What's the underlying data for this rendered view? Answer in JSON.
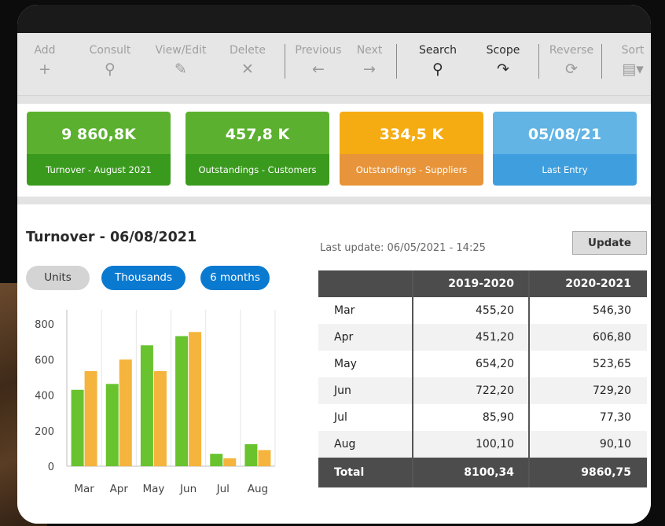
{
  "toolbar": {
    "items": [
      {
        "label": "Add",
        "icon": "plus-icon",
        "glyph": "+"
      },
      {
        "label": "Consult",
        "icon": "magnifier-icon",
        "glyph": "⚲"
      },
      {
        "label": "View/Edit",
        "icon": "pencil-icon",
        "glyph": "✎"
      },
      {
        "label": "Delete",
        "icon": "close-icon",
        "glyph": "✕"
      },
      {
        "label": "Previous",
        "icon": "arrow-left-icon",
        "glyph": "←"
      },
      {
        "label": "Next",
        "icon": "arrow-right-icon",
        "glyph": "→"
      },
      {
        "label": "Search",
        "icon": "search-icon",
        "glyph": "⚲"
      },
      {
        "label": "Scope",
        "icon": "redo-arrow-icon",
        "glyph": "↷"
      },
      {
        "label": "Reverse",
        "icon": "refresh-icon",
        "glyph": "⟳"
      },
      {
        "label": "Sort",
        "icon": "document-dropdown-icon",
        "glyph": "▤▾"
      }
    ]
  },
  "kpis": [
    {
      "value": "9 860,8K",
      "label": "Turnover - August 2021",
      "top": "#5bb12f",
      "bottom": "#3a9a1e"
    },
    {
      "value": "457,8 K",
      "label": "Outstandings - Customers",
      "top": "#5bb12f",
      "bottom": "#3a9a1e"
    },
    {
      "value": "334,5 K",
      "label": "Outstandings - Suppliers",
      "top": "#f5ac12",
      "bottom": "#e7943a"
    },
    {
      "value": "05/08/21",
      "label": "Last Entry",
      "top": "#62b4e4",
      "bottom": "#3f9edd"
    }
  ],
  "main": {
    "title": "Turnover - 06/08/2021",
    "last_update": "Last update: 06/05/2021 - 14:25",
    "update_label": "Update",
    "pills": [
      {
        "label": "Units",
        "style": "grey"
      },
      {
        "label": "Thousands",
        "style": "blue"
      },
      {
        "label": "6 months",
        "style": "blue"
      }
    ]
  },
  "chart_data": {
    "type": "bar",
    "categories": [
      "Mar",
      "Apr",
      "May",
      "Jun",
      "Jul",
      "Aug"
    ],
    "series": [
      {
        "values": [
          430,
          463,
          680,
          732,
          70,
          124
        ],
        "color": "#68c32e"
      },
      {
        "values": [
          535,
          600,
          535,
          755,
          45,
          91
        ],
        "color": "#f5b43d"
      }
    ],
    "yticks": [
      0,
      200,
      400,
      600,
      800
    ],
    "ylim": [
      0,
      880
    ],
    "grid": true
  },
  "table": {
    "headers": [
      "",
      "2019-2020",
      "2020-2021"
    ],
    "rows": [
      [
        "Mar",
        "455,20",
        "546,30"
      ],
      [
        "Apr",
        "451,20",
        "606,80"
      ],
      [
        "May",
        "654,20",
        "523,65"
      ],
      [
        "Jun",
        "722,20",
        "729,20"
      ],
      [
        "Jul",
        "85,90",
        "77,30"
      ],
      [
        "Aug",
        "100,10",
        "90,10"
      ]
    ],
    "total": [
      "Total",
      "8100,34",
      "9860,75"
    ]
  }
}
